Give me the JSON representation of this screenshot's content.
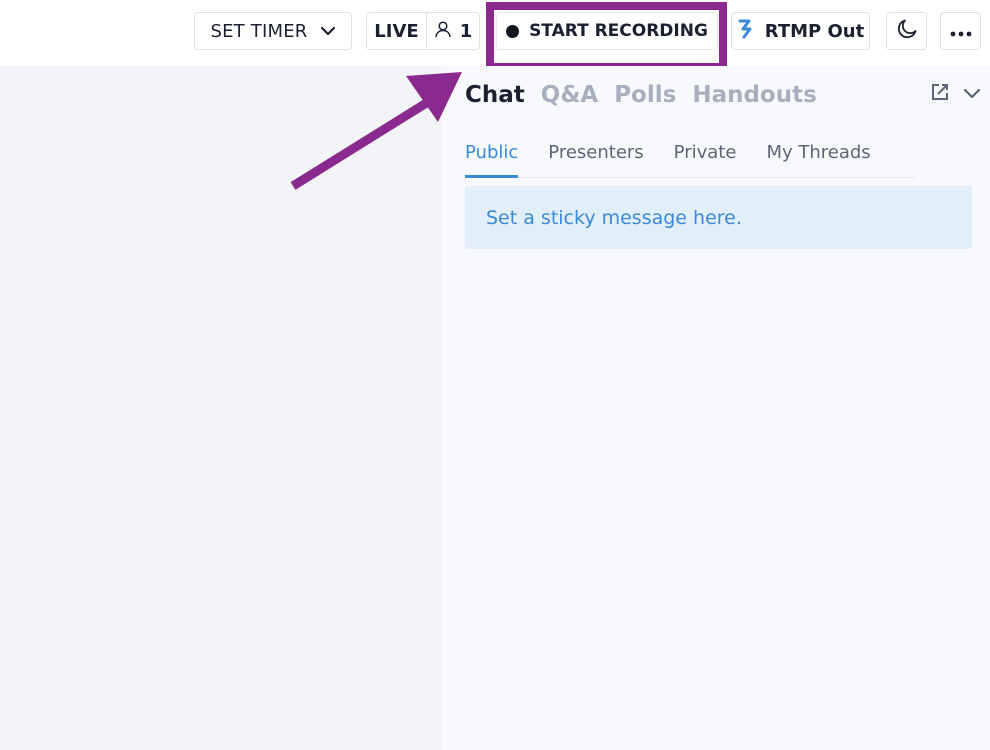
{
  "topbar": {
    "timer_label": "SET TIMER",
    "live_label": "LIVE",
    "viewer_count": "1",
    "record_label": "START RECORDING",
    "rtmp_label": "RTMP Out"
  },
  "panel": {
    "tabs": [
      {
        "label": "Chat",
        "active": true
      },
      {
        "label": "Q&A",
        "active": false
      },
      {
        "label": "Polls",
        "active": false
      },
      {
        "label": "Handouts",
        "active": false
      }
    ],
    "subtabs": [
      {
        "label": "Public",
        "active": true
      },
      {
        "label": "Presenters",
        "active": false
      },
      {
        "label": "Private",
        "active": false
      },
      {
        "label": "My Threads",
        "active": false
      }
    ],
    "sticky_placeholder": "Set a sticky message here."
  },
  "colors": {
    "annotation": "#8a2a8f",
    "accent": "#3b8ad8",
    "text_dark": "#1b2130",
    "tab_inactive": "#a8afbe"
  },
  "icons": {
    "timer_dropdown": "chevron-down-icon",
    "viewers": "user-icon",
    "record": "record-dot-icon",
    "rtmp": "rtmp-icon",
    "theme": "moon-icon",
    "more": "more-horizontal-icon",
    "popout": "external-link-icon",
    "collapse": "chevron-down-icon"
  }
}
